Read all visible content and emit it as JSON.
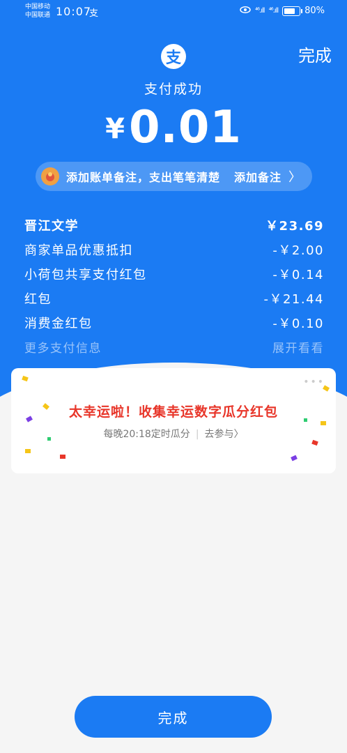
{
  "status_bar": {
    "carrier1": "中国移动",
    "carrier2": "中国联通",
    "time": "10:07",
    "app_glyph": "支",
    "signal1": "⁴⁶.ıll",
    "signal2": "⁴⁶.ıll",
    "battery": "80%"
  },
  "header": {
    "done_label": "完成",
    "logo_glyph": "支",
    "status_text": "支付成功",
    "currency": "¥",
    "amount": "0.01"
  },
  "note": {
    "text": "添加账单备注，支出笔笔清楚",
    "action": "添加备注",
    "chevron": "〉"
  },
  "details": [
    {
      "label": "晋江文学",
      "value": "￥23.69"
    },
    {
      "label": "商家单品优惠抵扣",
      "value": "-￥2.00"
    },
    {
      "label": "小荷包共享支付红包",
      "value": "-￥0.14"
    },
    {
      "label": "红包",
      "value": "-￥21.44"
    },
    {
      "label": "消费金红包",
      "value": "-￥0.10"
    }
  ],
  "more": {
    "label": "更多支付信息",
    "action": "展开看看"
  },
  "promo": {
    "title": "太幸运啦！收集幸运数字瓜分红包",
    "sub_left": "每晚20:18定时瓜分",
    "sub_sep": "|",
    "sub_right": "去参与〉",
    "dots": "•••"
  },
  "bottom": {
    "done_label": "完成"
  },
  "colors": {
    "brand": "#1b7bf3",
    "promo_red": "#e8362a"
  }
}
